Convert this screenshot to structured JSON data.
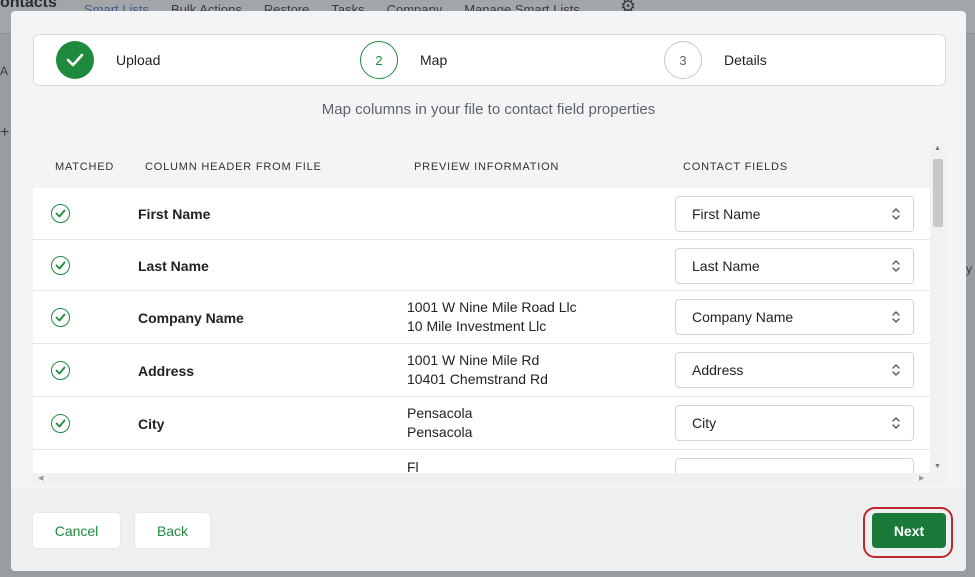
{
  "background": {
    "title": "ontacts",
    "nav": [
      "Smart Lists",
      "Bulk Actions",
      "Restore",
      "Tasks",
      "Company",
      "Manage Smart Lists"
    ],
    "side_a": "A",
    "side_plus": "+",
    "side_y": "y"
  },
  "stepper": {
    "steps": [
      {
        "number": "1",
        "label": "Upload",
        "state": "done"
      },
      {
        "number": "2",
        "label": "Map",
        "state": "active"
      },
      {
        "number": "3",
        "label": "Details",
        "state": "pending"
      }
    ]
  },
  "subtitle": "Map columns in your file to contact field properties",
  "table": {
    "headers": [
      "MATCHED",
      "COLUMN HEADER FROM FILE",
      "PREVIEW INFORMATION",
      "CONTACT FIELDS"
    ],
    "rows": [
      {
        "column": "First Name",
        "preview": [
          "",
          ""
        ],
        "field": "First Name"
      },
      {
        "column": "Last Name",
        "preview": [
          "",
          ""
        ],
        "field": "Last Name"
      },
      {
        "column": "Company Name",
        "preview": [
          "1001 W Nine Mile Road Llc",
          "10 Mile Investment Llc"
        ],
        "field": "Company Name"
      },
      {
        "column": "Address",
        "preview": [
          "1001 W Nine Mile Rd",
          "10401 Chemstrand Rd"
        ],
        "field": "Address"
      },
      {
        "column": "City",
        "preview": [
          "Pensacola",
          "Pensacola"
        ],
        "field": "City"
      },
      {
        "column": "",
        "preview": [
          "Fl",
          ""
        ],
        "field": ""
      }
    ]
  },
  "footer": {
    "cancel_label": "Cancel",
    "back_label": "Back",
    "next_label": "Next"
  },
  "colors": {
    "accent": "#1f8a3e",
    "next_button": "#1a7a3a",
    "highlight": "#c0262c"
  }
}
